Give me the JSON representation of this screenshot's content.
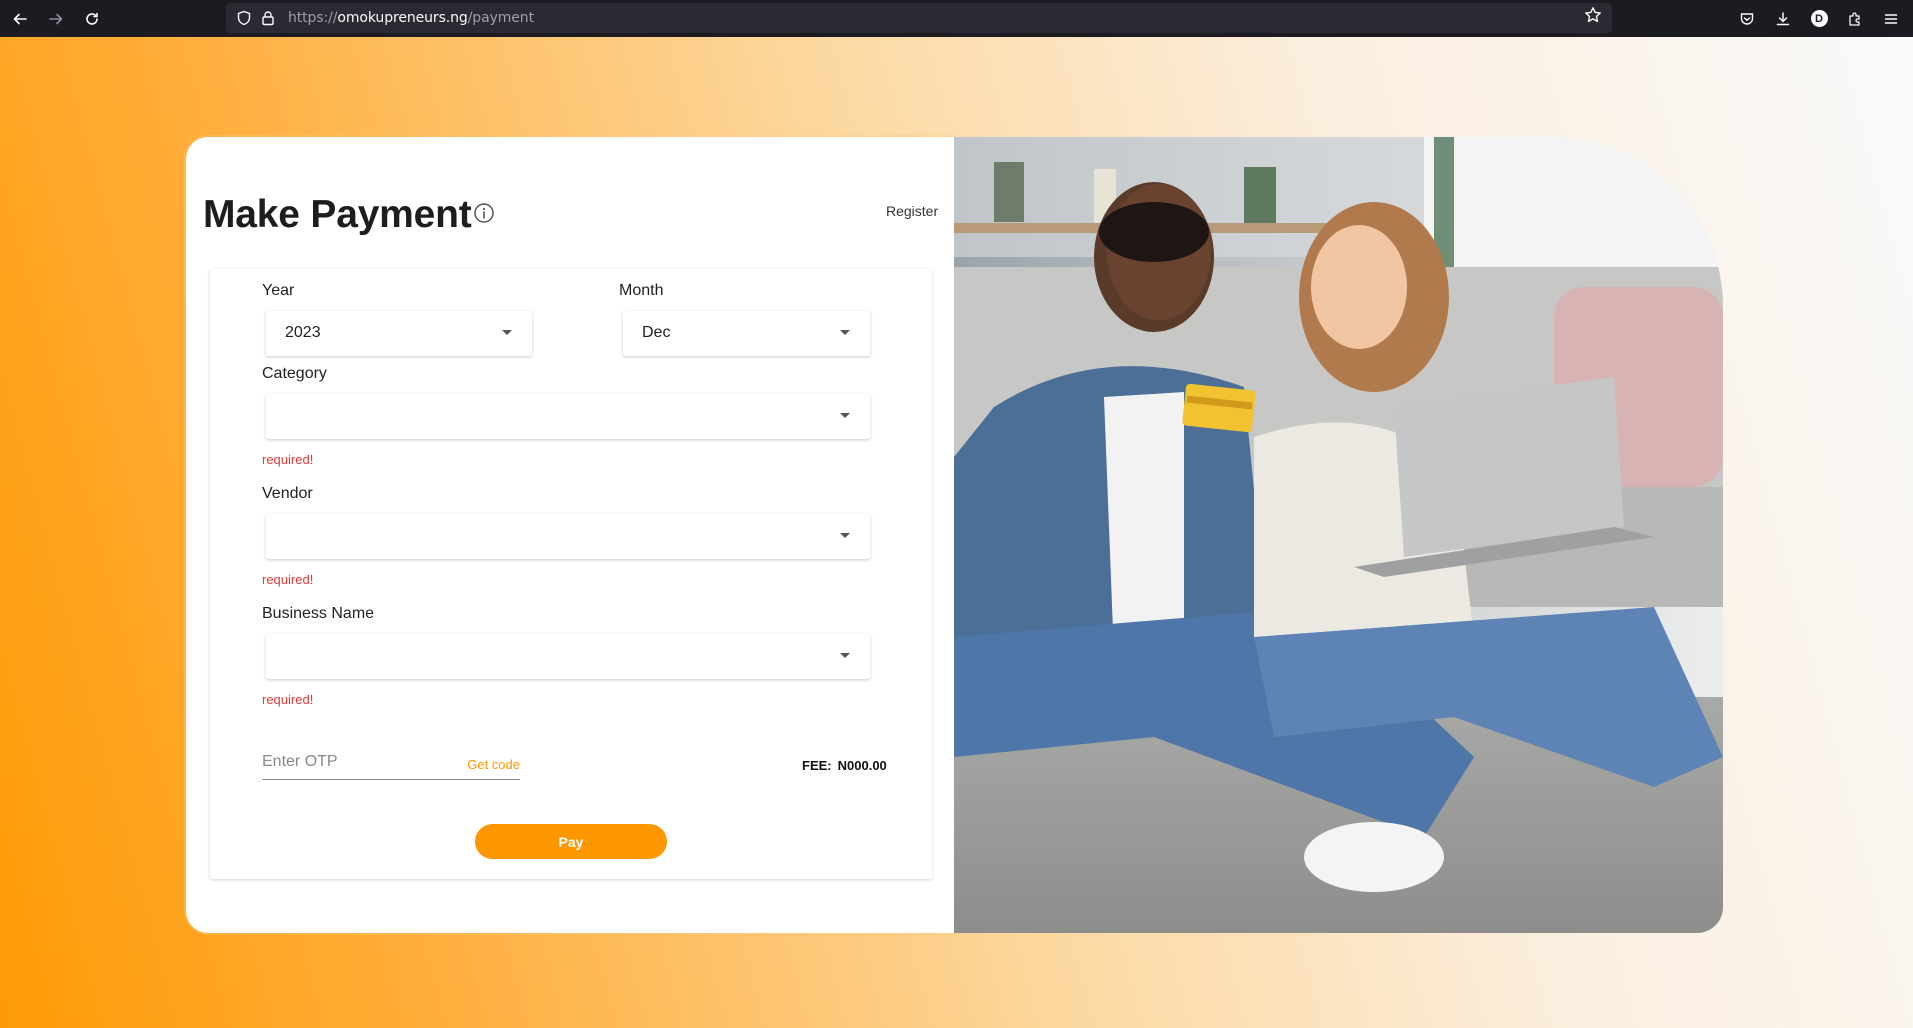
{
  "browser": {
    "url_prefix": "https://",
    "url_host": "omokupreneurs.ng",
    "url_path": "/payment",
    "profile_initial": "D"
  },
  "page": {
    "title": "Make Payment",
    "register_label": "Register",
    "form": {
      "year": {
        "label": "Year",
        "value": "2023"
      },
      "month": {
        "label": "Month",
        "value": "Dec"
      },
      "category": {
        "label": "Category",
        "value": "",
        "error": "required!"
      },
      "vendor": {
        "label": "Vendor",
        "value": "",
        "error": "required!"
      },
      "business_name": {
        "label": "Business Name",
        "value": "",
        "error": "required!"
      },
      "otp": {
        "placeholder": "Enter OTP",
        "get_code_label": "Get code"
      },
      "fee": {
        "label": "FEE:",
        "value": "N000.00"
      },
      "pay_label": "Pay"
    }
  },
  "colors": {
    "accent": "#ff9800",
    "error": "#e53935"
  }
}
